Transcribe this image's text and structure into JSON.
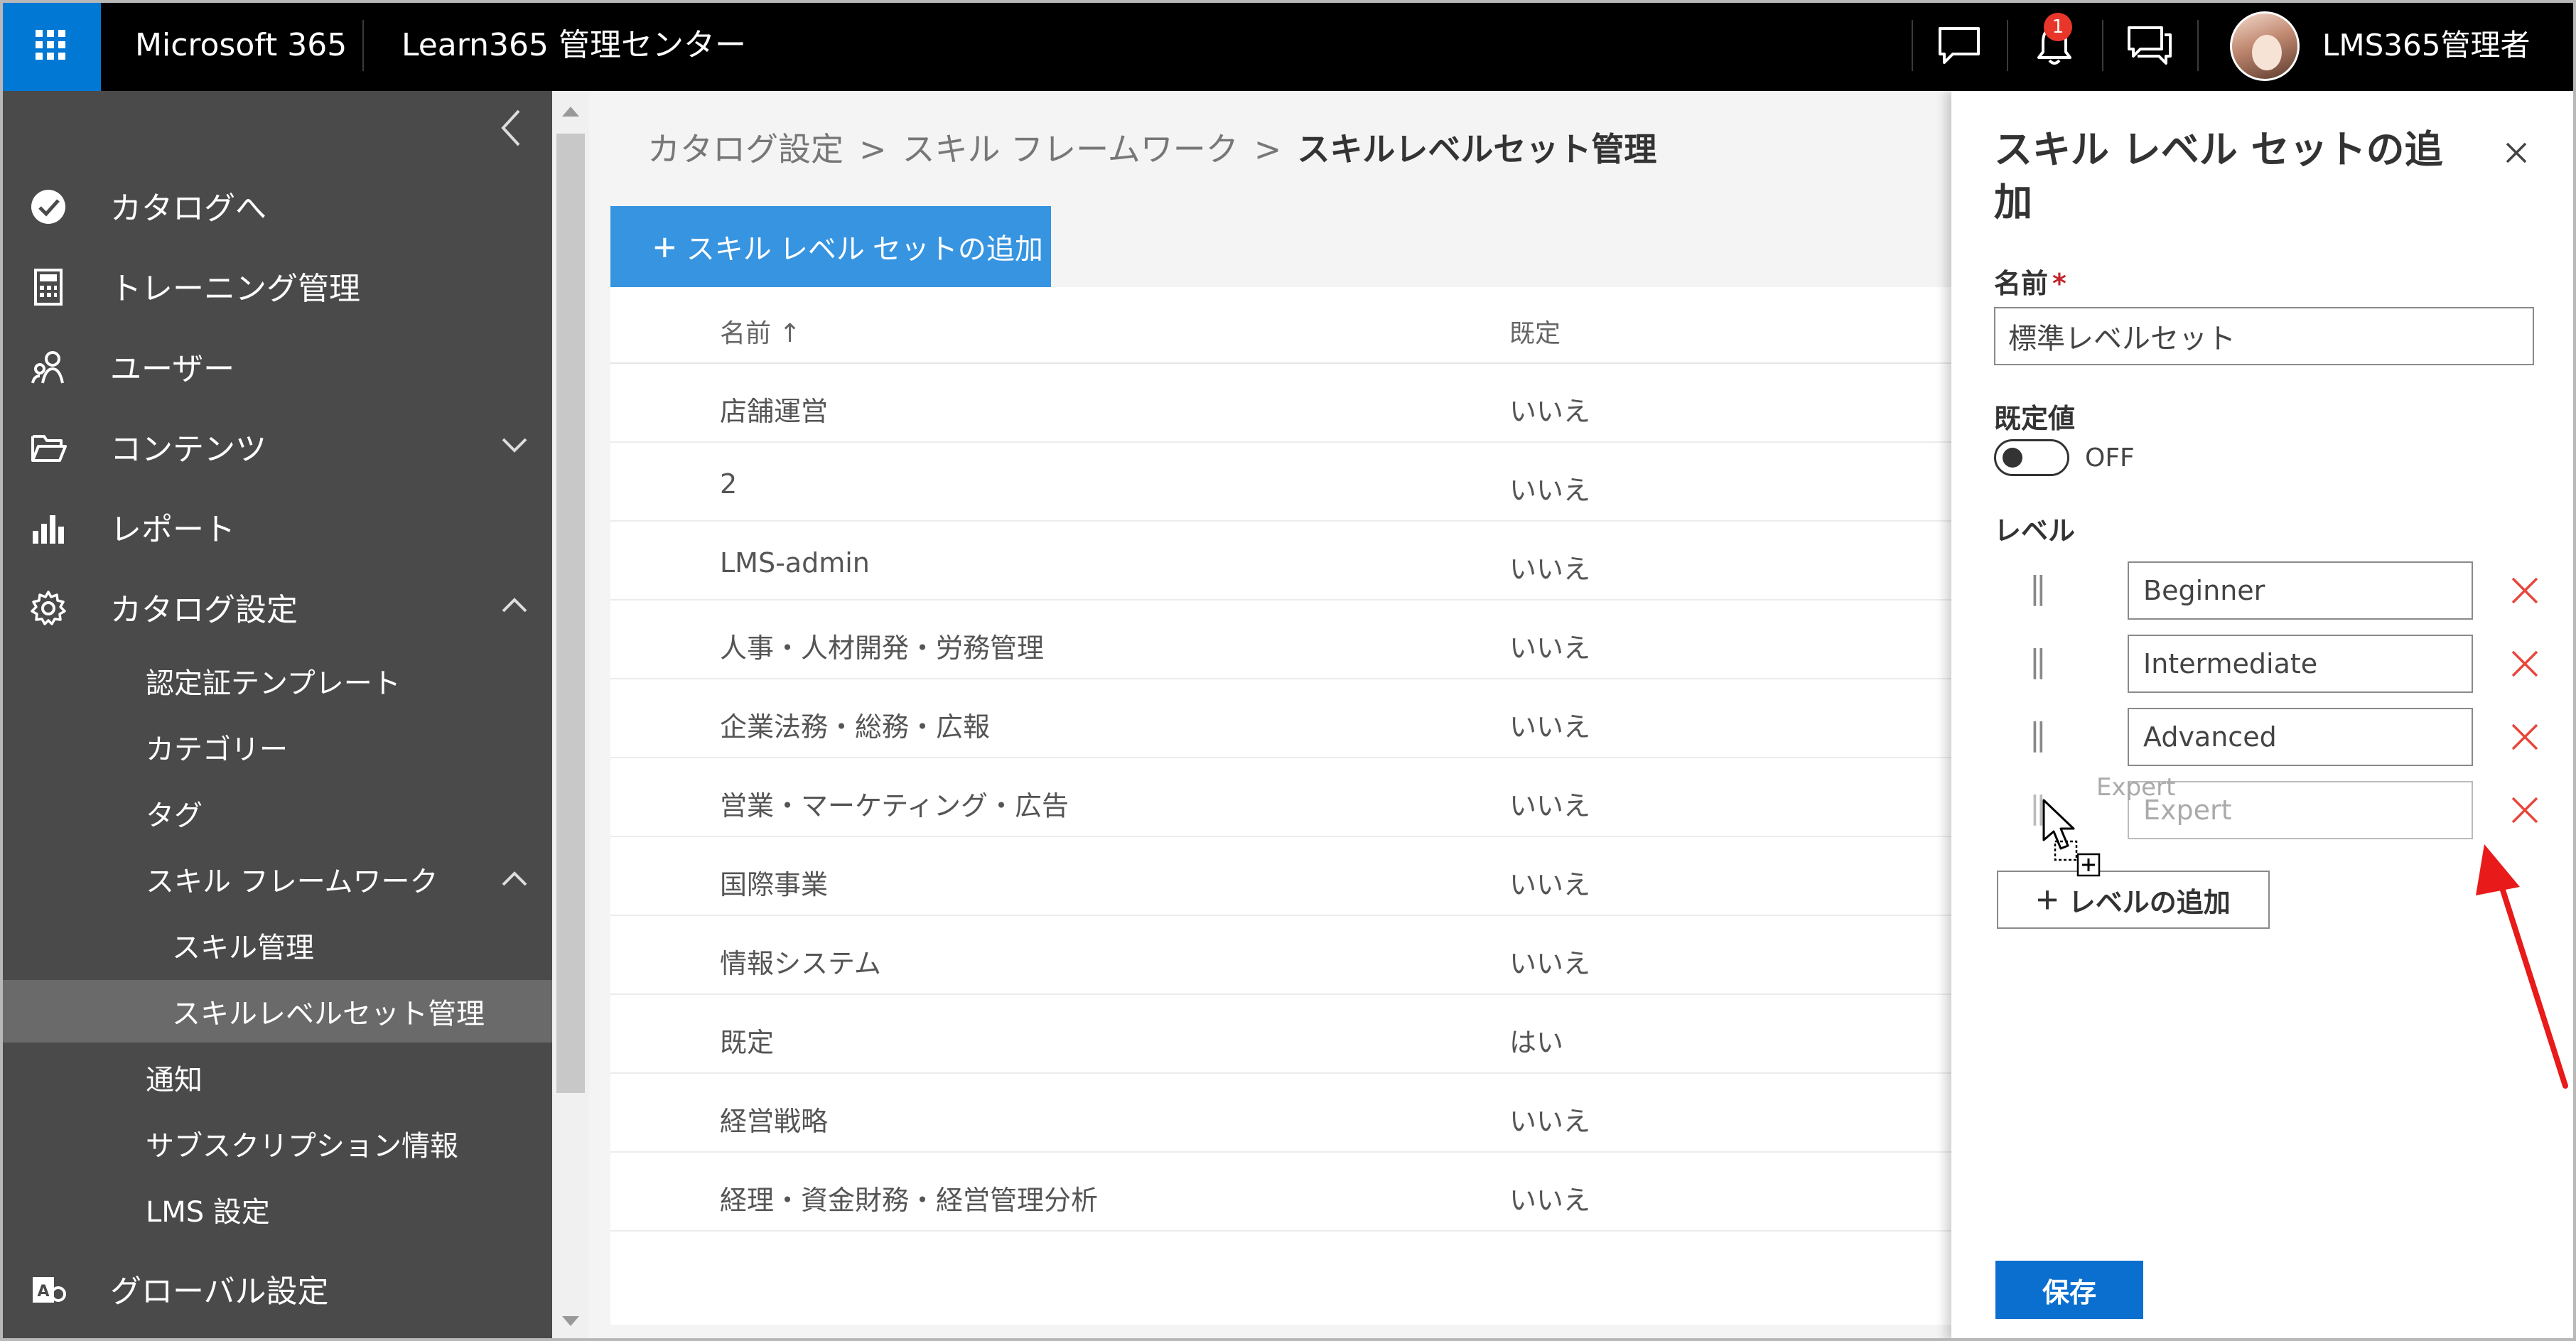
{
  "topbar": {
    "brand": "Microsoft 365",
    "app_title": "Learn365 管理センター",
    "notification_count": "1",
    "user_name": "LMS365管理者"
  },
  "sidebar": {
    "items": [
      {
        "label": "カタログへ",
        "icon": "check-circle-icon"
      },
      {
        "label": "トレーニング管理",
        "icon": "calculator-icon"
      },
      {
        "label": "ユーザー",
        "icon": "people-icon"
      },
      {
        "label": "コンテンツ",
        "icon": "folder-open-icon"
      },
      {
        "label": "レポート",
        "icon": "bar-chart-icon"
      },
      {
        "label": "カタログ設定",
        "icon": "gear-icon"
      }
    ],
    "sub_items": {
      "cert_template": "認定証テンプレート",
      "category": "カテゴリー",
      "tag": "タグ",
      "skill_framework": "スキル フレームワーク",
      "skill_manage": "スキル管理",
      "skill_level_set": "スキルレベルセット管理",
      "notice": "通知",
      "subscription": "サブスクリプション情報",
      "lms_settings": "LMS 設定"
    },
    "global": "グローバル設定"
  },
  "breadcrumb": {
    "items": [
      "カタログ設定",
      "スキル フレームワーク"
    ],
    "current": "スキルレベルセット管理",
    "separator": ">"
  },
  "toolbar": {
    "add_set_plus": "+",
    "add_set_label": "スキル レベル セットの追加"
  },
  "table": {
    "headers": {
      "name": "名前 ↑",
      "default": "既定"
    },
    "rows": [
      {
        "name": "店舗運営",
        "default": "いいえ"
      },
      {
        "name": "2",
        "default": "いいえ"
      },
      {
        "name": "LMS-admin",
        "default": "いいえ"
      },
      {
        "name": "人事・人材開発・労務管理",
        "default": "いいえ"
      },
      {
        "name": "企業法務・総務・広報",
        "default": "いいえ"
      },
      {
        "name": "営業・マーケティング・広告",
        "default": "いいえ"
      },
      {
        "name": "国際事業",
        "default": "いいえ"
      },
      {
        "name": "情報システム",
        "default": "いいえ"
      },
      {
        "name": "既定",
        "default": "はい"
      },
      {
        "name": "経営戦略",
        "default": "いいえ"
      },
      {
        "name": "経理・資金財務・経営管理分析",
        "default": "いいえ"
      }
    ]
  },
  "panel": {
    "title": "スキル レベル セットの追加",
    "name_label": "名前",
    "required_mark": "*",
    "name_value": "標準レベルセット",
    "default_label": "既定値",
    "toggle_state": "OFF",
    "levels_label": "レベル",
    "grip": "||",
    "levels": [
      "Beginner",
      "Intermediate",
      "Advanced",
      "Expert"
    ],
    "ghost_text": "Expert",
    "add_level_plus": "+",
    "add_level_label": "レベルの追加",
    "save_label": "保存"
  },
  "colors": {
    "accent": "#0078d4",
    "sidebar_bg": "#4a4a4a",
    "delete_icon": "#e8463a",
    "annotation_arrow": "#e81a1a"
  }
}
